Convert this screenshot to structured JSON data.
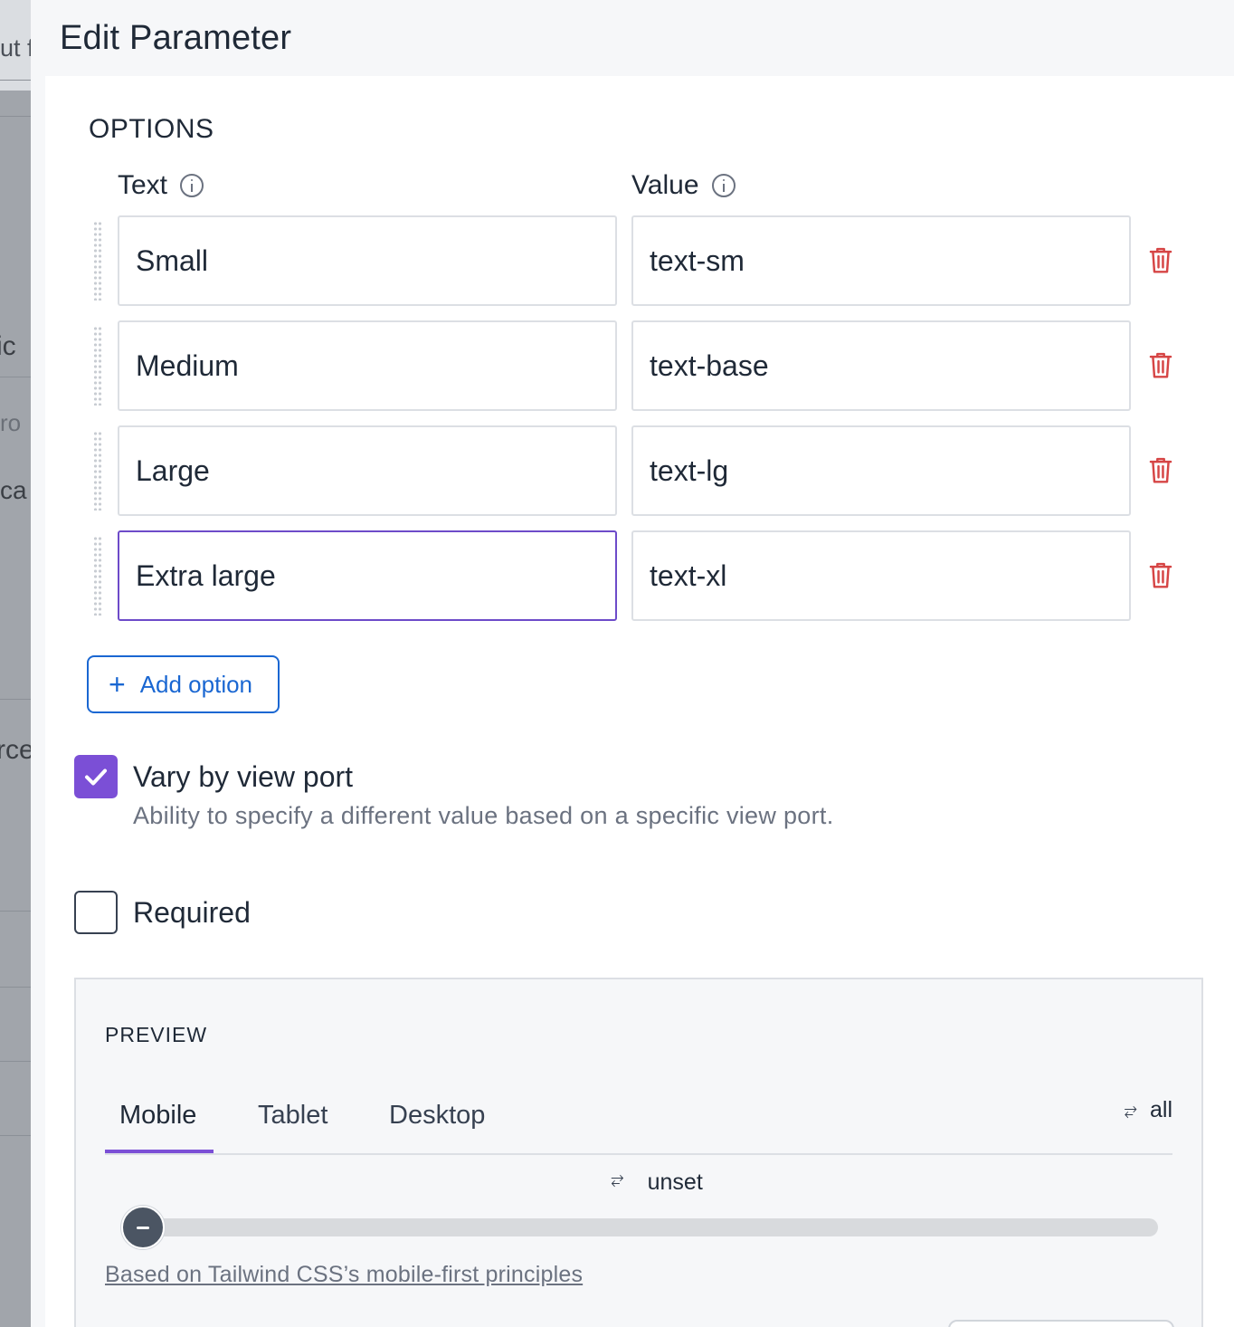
{
  "background": {
    "fragments": [
      "ut f",
      "ic",
      "ro",
      "ca",
      "rce"
    ]
  },
  "drawer": {
    "title": "Edit Parameter"
  },
  "options": {
    "section_title": "OPTIONS",
    "text_header": "Text",
    "value_header": "Value",
    "rows": [
      {
        "text": "Small",
        "value": "text-sm"
      },
      {
        "text": "Medium",
        "value": "text-base"
      },
      {
        "text": "Large",
        "value": "text-lg"
      },
      {
        "text": "Extra large",
        "value": "text-xl"
      }
    ],
    "add_label": "Add option"
  },
  "vary": {
    "checked": true,
    "label": "Vary by view port",
    "description": "Ability to specify a different value based on a specific view port."
  },
  "required": {
    "checked": false,
    "label": "Required"
  },
  "preview": {
    "title": "PREVIEW",
    "tabs": [
      "Mobile",
      "Tablet",
      "Desktop"
    ],
    "active_tab": "Mobile",
    "sync_all_label": "all",
    "slider_value_label": "unset",
    "link_text": "Based on Tailwind CSS’s mobile-first principles"
  },
  "colors": {
    "accent": "#7b4fd6",
    "link_blue": "#1a67d2",
    "danger": "#d64545"
  }
}
